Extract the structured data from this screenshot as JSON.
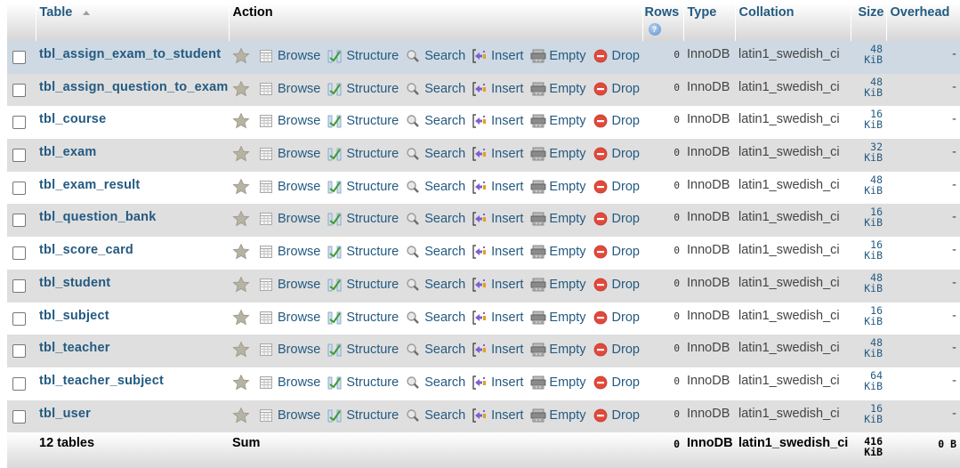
{
  "header": {
    "table": "Table",
    "action": "Action",
    "rows": "Rows",
    "type": "Type",
    "collation": "Collation",
    "size": "Size",
    "overhead": "Overhead"
  },
  "actions": {
    "browse": "Browse",
    "structure": "Structure",
    "search": "Search",
    "insert": "Insert",
    "empty": "Empty",
    "drop": "Drop"
  },
  "icons": {
    "favorite": "star-icon",
    "browse": "browse-table-icon",
    "structure": "structure-icon",
    "search": "search-icon",
    "insert": "insert-row-icon",
    "empty": "empty-table-icon",
    "drop": "drop-icon",
    "rows_help": "help-icon",
    "sort": "sort-ascending-icon"
  },
  "colors": {
    "link": "#235a81",
    "row_hover": "#ced9e3",
    "row_even": "#dfdfdf",
    "drop_red": "#e2493b"
  },
  "tables": [
    {
      "name": "tbl_assign_exam_to_student",
      "rows": "0",
      "type": "InnoDB",
      "collation": "latin1_swedish_ci",
      "size": "48",
      "size_unit": "KiB",
      "overhead": "-"
    },
    {
      "name": "tbl_assign_question_to_exam",
      "rows": "0",
      "type": "InnoDB",
      "collation": "latin1_swedish_ci",
      "size": "48",
      "size_unit": "KiB",
      "overhead": "-"
    },
    {
      "name": "tbl_course",
      "rows": "0",
      "type": "InnoDB",
      "collation": "latin1_swedish_ci",
      "size": "16",
      "size_unit": "KiB",
      "overhead": "-"
    },
    {
      "name": "tbl_exam",
      "rows": "0",
      "type": "InnoDB",
      "collation": "latin1_swedish_ci",
      "size": "32",
      "size_unit": "KiB",
      "overhead": "-"
    },
    {
      "name": "tbl_exam_result",
      "rows": "0",
      "type": "InnoDB",
      "collation": "latin1_swedish_ci",
      "size": "48",
      "size_unit": "KiB",
      "overhead": "-"
    },
    {
      "name": "tbl_question_bank",
      "rows": "0",
      "type": "InnoDB",
      "collation": "latin1_swedish_ci",
      "size": "16",
      "size_unit": "KiB",
      "overhead": "-"
    },
    {
      "name": "tbl_score_card",
      "rows": "0",
      "type": "InnoDB",
      "collation": "latin1_swedish_ci",
      "size": "16",
      "size_unit": "KiB",
      "overhead": "-"
    },
    {
      "name": "tbl_student",
      "rows": "0",
      "type": "InnoDB",
      "collation": "latin1_swedish_ci",
      "size": "48",
      "size_unit": "KiB",
      "overhead": "-"
    },
    {
      "name": "tbl_subject",
      "rows": "0",
      "type": "InnoDB",
      "collation": "latin1_swedish_ci",
      "size": "16",
      "size_unit": "KiB",
      "overhead": "-"
    },
    {
      "name": "tbl_teacher",
      "rows": "0",
      "type": "InnoDB",
      "collation": "latin1_swedish_ci",
      "size": "48",
      "size_unit": "KiB",
      "overhead": "-"
    },
    {
      "name": "tbl_teacher_subject",
      "rows": "0",
      "type": "InnoDB",
      "collation": "latin1_swedish_ci",
      "size": "64",
      "size_unit": "KiB",
      "overhead": "-"
    },
    {
      "name": "tbl_user",
      "rows": "0",
      "type": "InnoDB",
      "collation": "latin1_swedish_ci",
      "size": "16",
      "size_unit": "KiB",
      "overhead": "-"
    }
  ],
  "footer": {
    "count": "12 tables",
    "sum_label": "Sum",
    "rows": "0",
    "type": "InnoDB",
    "collation": "latin1_swedish_ci",
    "size": "416",
    "size_unit": "KiB",
    "overhead": "0 B"
  }
}
